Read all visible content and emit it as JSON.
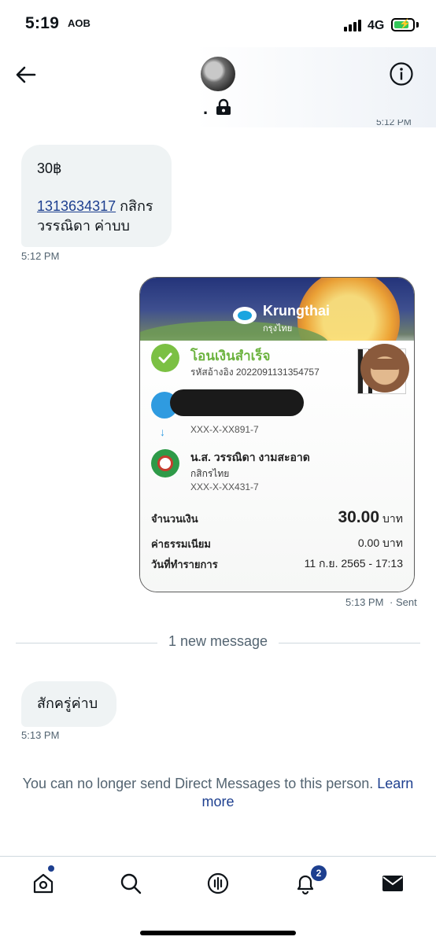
{
  "status_bar": {
    "time": "5:19",
    "glyph": "AOB",
    "network": "4G"
  },
  "header": {
    "display_name": "."
  },
  "messages": [
    {
      "amount_line": "30฿",
      "account_number": "1313634317",
      "after_link": " กสิกร",
      "line3": "วรรณิดา ค่าบบ",
      "time": "5:12 PM"
    },
    {
      "time": "5:13 PM",
      "status": "· Sent"
    },
    {
      "text": "สักครู่ค่าบ",
      "time": "5:13 PM"
    }
  ],
  "slip": {
    "bank_name": "Krungthai",
    "bank_name_thai": "กรุงไทย",
    "status_title": "โอนเงินสำเร็จ",
    "reference": "รหัสอ้างอิง 2022091131354757",
    "sender_account": "XXX-X-XX891-7",
    "receiver_name": "น.ส. วรรณิดา งามสะอาด",
    "receiver_bank": "กสิกรไทย",
    "receiver_account": "XXX-X-XX431-7",
    "amount_label": "จำนวนเงิน",
    "amount_value": "30.00",
    "amount_unit": "บาท",
    "fee_label": "ค่าธรรมเนียม",
    "fee_value": "0.00 บาท",
    "date_label": "วันที่ทำรายการ",
    "date_value": "11 ก.ย. 2565 - 17:13"
  },
  "divider": {
    "label": "1 new message"
  },
  "notice": {
    "text": "You can no longer send Direct Messages to this person. ",
    "link": "Learn more"
  },
  "tab_bar": {
    "notification_count": "2"
  },
  "colors": {
    "accent": "#1d3f8f",
    "bubble": "#eff3f4",
    "secondary_text": "#536471",
    "success_green": "#7bc043"
  }
}
